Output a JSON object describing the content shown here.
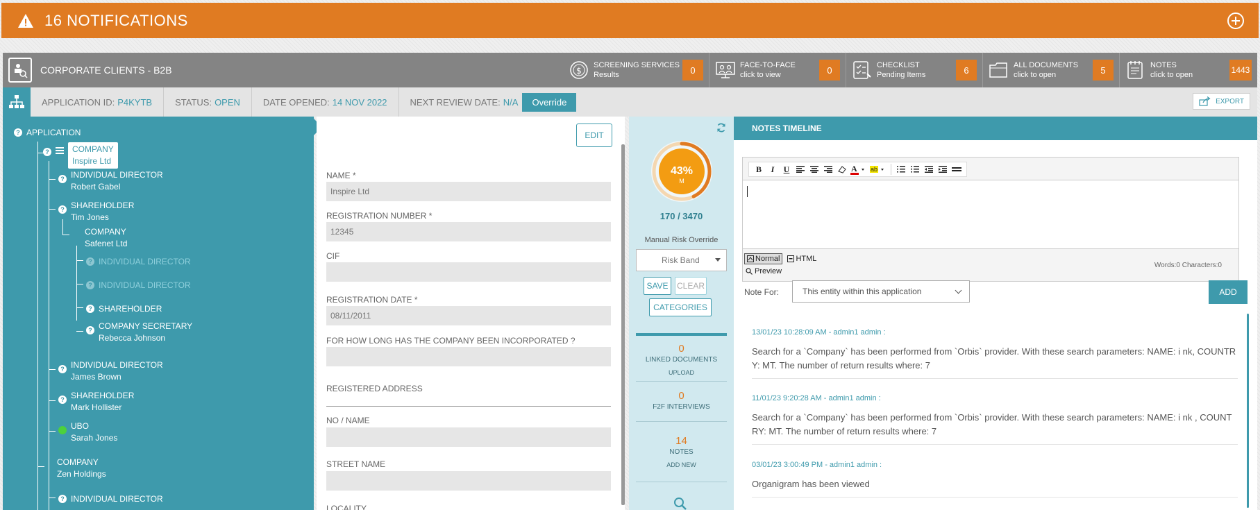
{
  "notifications": {
    "title": "16 NOTIFICATIONS"
  },
  "header": {
    "title": "CORPORATE CLIENTS - B2B",
    "sections": [
      {
        "l1": "SCREENING SERVICES",
        "l2": "Results",
        "count": "0"
      },
      {
        "l1": "FACE-TO-FACE",
        "l2": "click to view",
        "count": "0"
      },
      {
        "l1": "CHECKLIST",
        "l2": "Pending Items",
        "count": "6"
      },
      {
        "l1": "ALL DOCUMENTS",
        "l2": "click to open",
        "count": "5"
      },
      {
        "l1": "NOTES",
        "l2": "click to open",
        "count": "1443"
      }
    ]
  },
  "info": {
    "app_id_label": "APPLICATION ID:",
    "app_id": "P4KYTB",
    "status_label": "STATUS:",
    "status": "OPEN",
    "opened_label": "DATE OPENED:",
    "opened": "14 NOV 2022",
    "review_label": "NEXT REVIEW DATE:",
    "review": "N/A",
    "override": "Override",
    "export": "EXPORT"
  },
  "tree": {
    "root": "APPLICATION",
    "nodes": [
      {
        "type": "COMPANY",
        "name": "Inspire Ltd"
      },
      {
        "type": "INDIVIDUAL DIRECTOR",
        "name": "Robert Gabel"
      },
      {
        "type": "SHAREHOLDER",
        "name": "Tim Jones"
      },
      {
        "type": "COMPANY",
        "name": "Safenet Ltd"
      },
      {
        "type": "INDIVIDUAL DIRECTOR",
        "name": ""
      },
      {
        "type": "INDIVIDUAL DIRECTOR",
        "name": ""
      },
      {
        "type": "SHAREHOLDER",
        "name": ""
      },
      {
        "type": "COMPANY SECRETARY",
        "name": "Rebecca Johnson"
      },
      {
        "type": "INDIVIDUAL DIRECTOR",
        "name": "James Brown"
      },
      {
        "type": "SHAREHOLDER",
        "name": "Mark Hollister"
      },
      {
        "type": "UBO",
        "name": "Sarah Jones"
      },
      {
        "type": "COMPANY",
        "name": "Zen Holdings"
      },
      {
        "type": "INDIVIDUAL DIRECTOR",
        "name": ""
      }
    ]
  },
  "form": {
    "edit": "EDIT",
    "fields": [
      {
        "label": "NAME *",
        "value": "Inspire Ltd"
      },
      {
        "label": "REGISTRATION NUMBER *",
        "value": "12345"
      },
      {
        "label": "CIF",
        "value": ""
      },
      {
        "label": "REGISTRATION DATE *",
        "value": "08/11/2011"
      },
      {
        "label": "FOR HOW LONG HAS THE COMPANY BEEN INCORPORATED ?",
        "value": ""
      },
      {
        "label": "REGISTERED ADDRESS",
        "value": ""
      },
      {
        "label": "NO / NAME",
        "value": ""
      },
      {
        "label": "STREET NAME",
        "value": ""
      },
      {
        "label": "LOCALITY",
        "value": ""
      }
    ]
  },
  "risk": {
    "percent": "43%",
    "level": "M",
    "percent_value": 43,
    "score": "170 / 3470",
    "manual_label": "Manual Risk Override",
    "risk_band": "Risk Band",
    "save": "SAVE",
    "clear": "CLEAR",
    "categories": "CATEGORIES",
    "blocks": [
      {
        "n": "0",
        "t": "LINKED DOCUMENTS",
        "a": "UPLOAD"
      },
      {
        "n": "0",
        "t": "F2F INTERVIEWS",
        "a": ""
      },
      {
        "n": "14",
        "t": "NOTES",
        "a": "ADD NEW"
      }
    ],
    "colors": {
      "gauge": "#f39c12",
      "ring": "#e8b070"
    }
  },
  "notes": {
    "title": "NOTES TIMELINE",
    "mode_normal": "Normal",
    "mode_html": "HTML",
    "preview": "Preview",
    "word_count": "Words:0 Characters:0",
    "note_for_label": "Note For:",
    "note_for_value": "This entity within this application",
    "add": "ADD",
    "entries": [
      {
        "meta": "13/01/23 10:28:09 AM - admin1 admin :",
        "text": "Search for a `Company` has been performed from `Orbis` provider. With these search parameters: NAME: i nk, COUNTRY: MT. The number of return results where: 7"
      },
      {
        "meta": "11/01/23 9:20:28 AM - admin1 admin :",
        "text": "Search for a `Company` has been performed from `Orbis` provider. With these search parameters: NAME: i nk , COUNTRY: MT. The number of return results where: 7"
      },
      {
        "meta": "03/01/23 3:00:49 PM - admin1 admin :",
        "text": "Organigram has been viewed"
      }
    ]
  }
}
